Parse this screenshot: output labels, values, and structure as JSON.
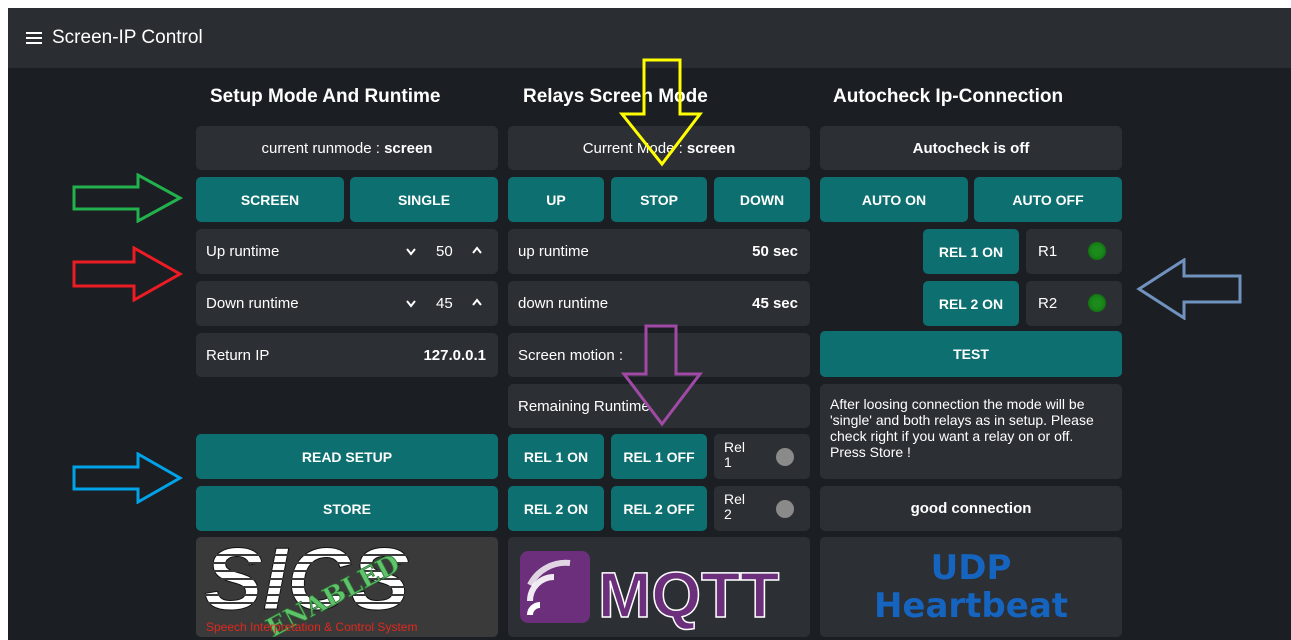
{
  "app": {
    "title": "Screen-IP Control"
  },
  "setup": {
    "title": "Setup Mode And Runtime",
    "runmode_label": "current runmode : ",
    "runmode_value": "screen",
    "screen_button": "SCREEN",
    "single_button": "SINGLE",
    "up_runtime_label": "Up runtime",
    "up_runtime_value": "50",
    "down_runtime_label": "Down runtime",
    "down_runtime_value": "45",
    "return_ip_label": "Return IP",
    "return_ip_value": "127.0.0.1",
    "read_setup_button": "READ SETUP",
    "store_button": "STORE"
  },
  "relays": {
    "title": "Relays Screen Mode",
    "mode_label": "Current Mode : ",
    "mode_value": "screen",
    "up_button": "UP",
    "stop_button": "STOP",
    "down_button": "DOWN",
    "up_runtime_label": "up runtime",
    "up_runtime_value": "50 sec",
    "down_runtime_label": "down runtime",
    "down_runtime_value": "45 sec",
    "motion_label": "Screen motion :",
    "remaining_label": "Remaining Runtime",
    "rel1_on": "REL 1 ON",
    "rel1_off": "REL 1 OFF",
    "rel2_on": "REL 2 ON",
    "rel2_off": "REL 2 OFF",
    "rel1_status_label": "Rel 1",
    "rel2_status_label": "Rel 2"
  },
  "autocheck": {
    "title": "Autocheck Ip-Connection",
    "status": "Autocheck is off",
    "auto_on": "AUTO ON",
    "auto_off": "AUTO OFF",
    "rel1_on": "REL 1 ON",
    "rel2_on": "REL 2 ON",
    "r1_label": "R1",
    "r2_label": "R2",
    "test_button": "TEST",
    "note": "After loosing connection the mode will be 'single' and both relays as in setup. Please check right if you want a relay on or off. Press Store !",
    "connection": "good connection"
  },
  "logos": {
    "sics_letters": "SICS",
    "sics_stamp": "ENABLED",
    "sics_caption": "Speech Interpretation & Control System",
    "mqtt_text": "MQTT",
    "udp_line1": "UDP",
    "udp_line2": "Heartbeat"
  },
  "colors": {
    "background": "#1b1e22",
    "card": "#2c2f33",
    "button": "#0d6f6f",
    "led_on": "#1c8a1c",
    "led_off": "#8a8a8a",
    "arrow_yellow": "#ffff00",
    "arrow_purple": "#a04aa6",
    "arrow_green": "#22b14c",
    "arrow_red": "#ed1c24",
    "arrow_blue": "#00a2e8",
    "arrow_steel": "#7092be"
  },
  "icons": [
    "menu-icon",
    "chevron-down-icon",
    "chevron-up-icon",
    "led-indicator-icon",
    "arrow-annotation-icon"
  ]
}
